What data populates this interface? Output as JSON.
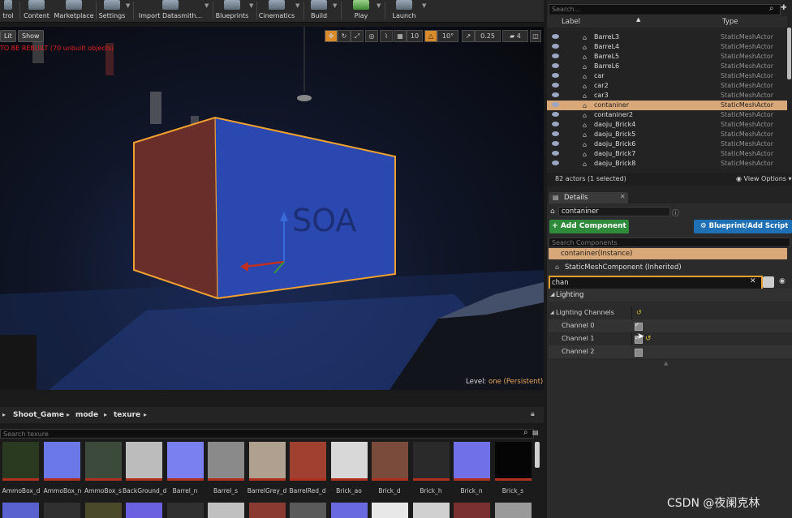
{
  "toolbar": {
    "items": [
      {
        "label": "trol",
        "icon": "trol-icon"
      },
      {
        "label": "Content",
        "icon": "content-icon"
      },
      {
        "label": "Marketplace",
        "icon": "marketplace-icon"
      },
      {
        "label": "Settings",
        "icon": "gear-icon"
      },
      {
        "label": "Import Datasmith...",
        "icon": "import-icon"
      },
      {
        "label": "Blueprints",
        "icon": "blueprint-icon"
      },
      {
        "label": "Cinematics",
        "icon": "cinematics-icon"
      },
      {
        "label": "Build",
        "icon": "build-icon"
      },
      {
        "label": "Play",
        "icon": "play-icon"
      },
      {
        "label": "Launch",
        "icon": "launch-icon"
      }
    ]
  },
  "viewport": {
    "lit_label": "Lit",
    "show_label": "Show",
    "warning": "TO BE REBUILT (70 unbuilt objects)",
    "grid_snap": "10",
    "rot_snap": "10°",
    "scale_snap": "0.25",
    "camera_speed": "4",
    "level_label": "Level:",
    "level_name": "one (Persistent)",
    "container_text": "SOA"
  },
  "content_browser": {
    "breadcrumb": [
      "Shoot_Game",
      "mode",
      "texure"
    ],
    "search_placeholder": "Search texure",
    "assets": [
      "AmmoBox_d",
      "AmmoBox_n",
      "AmmoBox_s",
      "BackGround_d",
      "Barrel_n",
      "Barrel_s",
      "BarrelGrey_d",
      "BarrelRed_d",
      "Brick_ao",
      "Brick_d",
      "Brick_h",
      "Brick_n",
      "Brick_s"
    ]
  },
  "outliner": {
    "search_placeholder": "Search...",
    "col_label": "Label",
    "col_type": "Type",
    "rows": [
      {
        "name": "BarreL3",
        "type": "StaticMeshActor",
        "selected": false
      },
      {
        "name": "BarreL4",
        "type": "StaticMeshActor",
        "selected": false
      },
      {
        "name": "BarreL5",
        "type": "StaticMeshActor",
        "selected": false
      },
      {
        "name": "BarreL6",
        "type": "StaticMeshActor",
        "selected": false
      },
      {
        "name": "car",
        "type": "StaticMeshActor",
        "selected": false
      },
      {
        "name": "car2",
        "type": "StaticMeshActor",
        "selected": false
      },
      {
        "name": "car3",
        "type": "StaticMeshActor",
        "selected": false
      },
      {
        "name": "contaniner",
        "type": "StaticMeshActor",
        "selected": true
      },
      {
        "name": "contaniner2",
        "type": "StaticMeshActor",
        "selected": false
      },
      {
        "name": "daoju_Brick4",
        "type": "StaticMeshActor",
        "selected": false
      },
      {
        "name": "daoju_Brick5",
        "type": "StaticMeshActor",
        "selected": false
      },
      {
        "name": "daoju_Brick6",
        "type": "StaticMeshActor",
        "selected": false
      },
      {
        "name": "daoju_Brick7",
        "type": "StaticMeshActor",
        "selected": false
      },
      {
        "name": "daoju_Brick8",
        "type": "StaticMeshActor",
        "selected": false
      }
    ],
    "status": "82 actors (1 selected)",
    "view_options": "View Options"
  },
  "details": {
    "tab_label": "Details",
    "actor_name": "contaniner",
    "add_component": "+ Add Component",
    "blueprint_script": "Blueprint/Add Script",
    "search_components_placeholder": "Search Components",
    "instance_label": "contaniner(Instance)",
    "component_label": "StaticMeshComponent (Inherited)",
    "filter_value": "chan",
    "section": "Lighting",
    "group": "Lighting Channels",
    "channels": [
      {
        "label": "Channel 0",
        "checked": true
      },
      {
        "label": "Channel 1",
        "checked": true
      },
      {
        "label": "Channel 2",
        "checked": false
      }
    ]
  },
  "watermark": "CSDN @夜阑克林",
  "colors": {
    "selected_row": "#d9a878",
    "add_component_green": "#2e8b3a",
    "blueprint_blue": "#1f6fb5",
    "selection_outline": "#f0a030"
  }
}
